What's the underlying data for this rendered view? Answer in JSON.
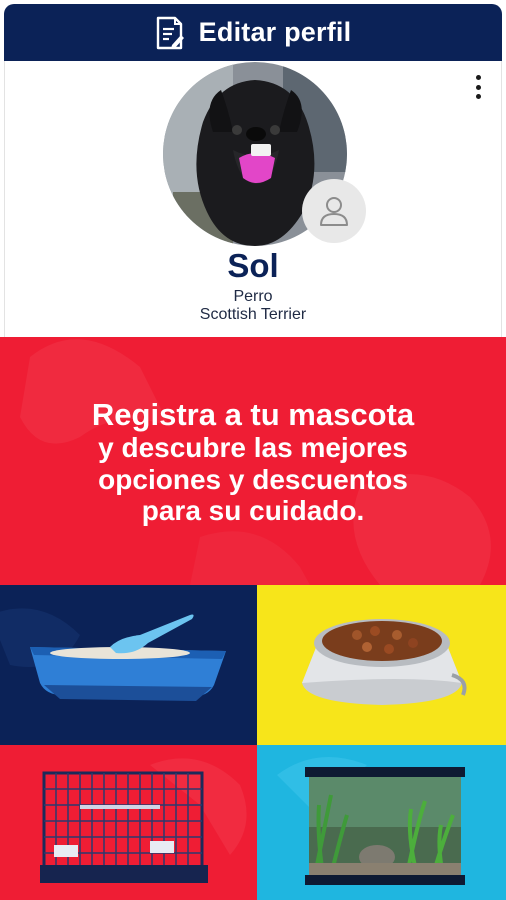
{
  "header": {
    "title": "Editar perfil",
    "icon": "edit-document-icon",
    "background": "#0b2257"
  },
  "profile": {
    "name": "Sol",
    "species": "Perro",
    "breed": "Scottish Terrier",
    "avatar_icon": "dog-photo",
    "edit_photo_icon": "user-icon",
    "menu_icon": "more-vertical-icon"
  },
  "promo": {
    "line1": "Registra a tu mascota",
    "line2": "y descubre las mejores",
    "line3": "opciones y descuentos",
    "line4": "para su cuidado.",
    "background": "#ef1d34"
  },
  "categories": [
    {
      "icon": "litter-box-image",
      "background": "#0b2257"
    },
    {
      "icon": "food-bowl-image",
      "background": "#f7e51a"
    },
    {
      "icon": "pet-cage-image",
      "background": "#ef1d34"
    },
    {
      "icon": "aquarium-image",
      "background": "#1fb6e0"
    }
  ]
}
